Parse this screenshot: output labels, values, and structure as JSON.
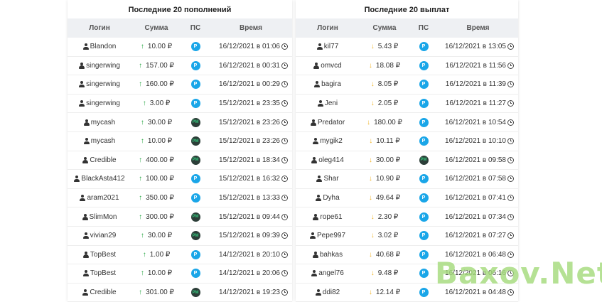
{
  "watermark": "Baxov.Net",
  "columns": {
    "login": "Логин",
    "sum": "Сумма",
    "ps": "ПС",
    "time": "Время"
  },
  "deposits": {
    "title": "Последние 20 пополнений",
    "rows": [
      {
        "login": "Blandon",
        "sum": "10.00 ₽",
        "ps": "payeer",
        "ps_label": "P",
        "time": "16/12/2021 в 01:06"
      },
      {
        "login": "singerwing",
        "sum": "157.00 ₽",
        "ps": "payeer",
        "ps_label": "P",
        "time": "16/12/2021 в 00:31"
      },
      {
        "login": "singerwing",
        "sum": "160.00 ₽",
        "ps": "payeer",
        "ps_label": "P",
        "time": "16/12/2021 в 00:29"
      },
      {
        "login": "singerwing",
        "sum": "3.00 ₽",
        "ps": "payeer",
        "ps_label": "P",
        "time": "15/12/2021 в 23:35"
      },
      {
        "login": "mycash",
        "sum": "30.00 ₽",
        "ps": "pm",
        "ps_label": "PM",
        "time": "15/12/2021 в 23:26"
      },
      {
        "login": "mycash",
        "sum": "10.00 ₽",
        "ps": "pm",
        "ps_label": "PM",
        "time": "15/12/2021 в 23:26"
      },
      {
        "login": "Credible",
        "sum": "400.00 ₽",
        "ps": "pm",
        "ps_label": "PM",
        "time": "15/12/2021 в 18:34"
      },
      {
        "login": "BlackAsta412",
        "sum": "100.00 ₽",
        "ps": "payeer",
        "ps_label": "P",
        "time": "15/12/2021 в 16:32"
      },
      {
        "login": "aram2021",
        "sum": "350.00 ₽",
        "ps": "payeer",
        "ps_label": "P",
        "time": "15/12/2021 в 13:33"
      },
      {
        "login": "SlimMon",
        "sum": "300.00 ₽",
        "ps": "pm",
        "ps_label": "PM",
        "time": "15/12/2021 в 09:44"
      },
      {
        "login": "vivian29",
        "sum": "30.00 ₽",
        "ps": "pm",
        "ps_label": "PM",
        "time": "15/12/2021 в 09:39"
      },
      {
        "login": "TopBest",
        "sum": "1.00 ₽",
        "ps": "payeer",
        "ps_label": "P",
        "time": "14/12/2021 в 20:10"
      },
      {
        "login": "TopBest",
        "sum": "10.00 ₽",
        "ps": "payeer",
        "ps_label": "P",
        "time": "14/12/2021 в 20:06"
      },
      {
        "login": "Credible",
        "sum": "301.00 ₽",
        "ps": "pm",
        "ps_label": "PM",
        "time": "14/12/2021 в 19:23"
      }
    ]
  },
  "payouts": {
    "title": "Последние 20 выплат",
    "rows": [
      {
        "login": "kil77",
        "sum": "5.43 ₽",
        "ps": "payeer",
        "ps_label": "P",
        "time": "16/12/2021 в 13:05"
      },
      {
        "login": "omvcd",
        "sum": "18.08 ₽",
        "ps": "payeer",
        "ps_label": "P",
        "time": "16/12/2021 в 11:56"
      },
      {
        "login": "bagira",
        "sum": "8.05 ₽",
        "ps": "payeer",
        "ps_label": "P",
        "time": "16/12/2021 в 11:39"
      },
      {
        "login": "Jeni",
        "sum": "2.05 ₽",
        "ps": "payeer",
        "ps_label": "P",
        "time": "16/12/2021 в 11:27"
      },
      {
        "login": "Predator",
        "sum": "180.00 ₽",
        "ps": "payeer",
        "ps_label": "P",
        "time": "16/12/2021 в 10:54"
      },
      {
        "login": "mygik2",
        "sum": "10.11 ₽",
        "ps": "payeer",
        "ps_label": "P",
        "time": "16/12/2021 в 10:10"
      },
      {
        "login": "oleg414",
        "sum": "30.00 ₽",
        "ps": "pm",
        "ps_label": "PM",
        "time": "16/12/2021 в 09:58"
      },
      {
        "login": "Shar",
        "sum": "10.90 ₽",
        "ps": "payeer",
        "ps_label": "P",
        "time": "16/12/2021 в 07:58"
      },
      {
        "login": "Dyha",
        "sum": "49.64 ₽",
        "ps": "payeer",
        "ps_label": "P",
        "time": "16/12/2021 в 07:41"
      },
      {
        "login": "rope61",
        "sum": "2.30 ₽",
        "ps": "payeer",
        "ps_label": "P",
        "time": "16/12/2021 в 07:34"
      },
      {
        "login": "Pepe997",
        "sum": "3.02 ₽",
        "ps": "payeer",
        "ps_label": "P",
        "time": "16/12/2021 в 07:27"
      },
      {
        "login": "bahkas",
        "sum": "40.68 ₽",
        "ps": "payeer",
        "ps_label": "P",
        "time": "16/12/2021 в 06:48"
      },
      {
        "login": "angel76",
        "sum": "9.48 ₽",
        "ps": "payeer",
        "ps_label": "P",
        "time": "16/12/2021 в 06:16"
      },
      {
        "login": "ddi82",
        "sum": "12.14 ₽",
        "ps": "payeer",
        "ps_label": "P",
        "time": "16/12/2021 в 04:48"
      }
    ]
  }
}
